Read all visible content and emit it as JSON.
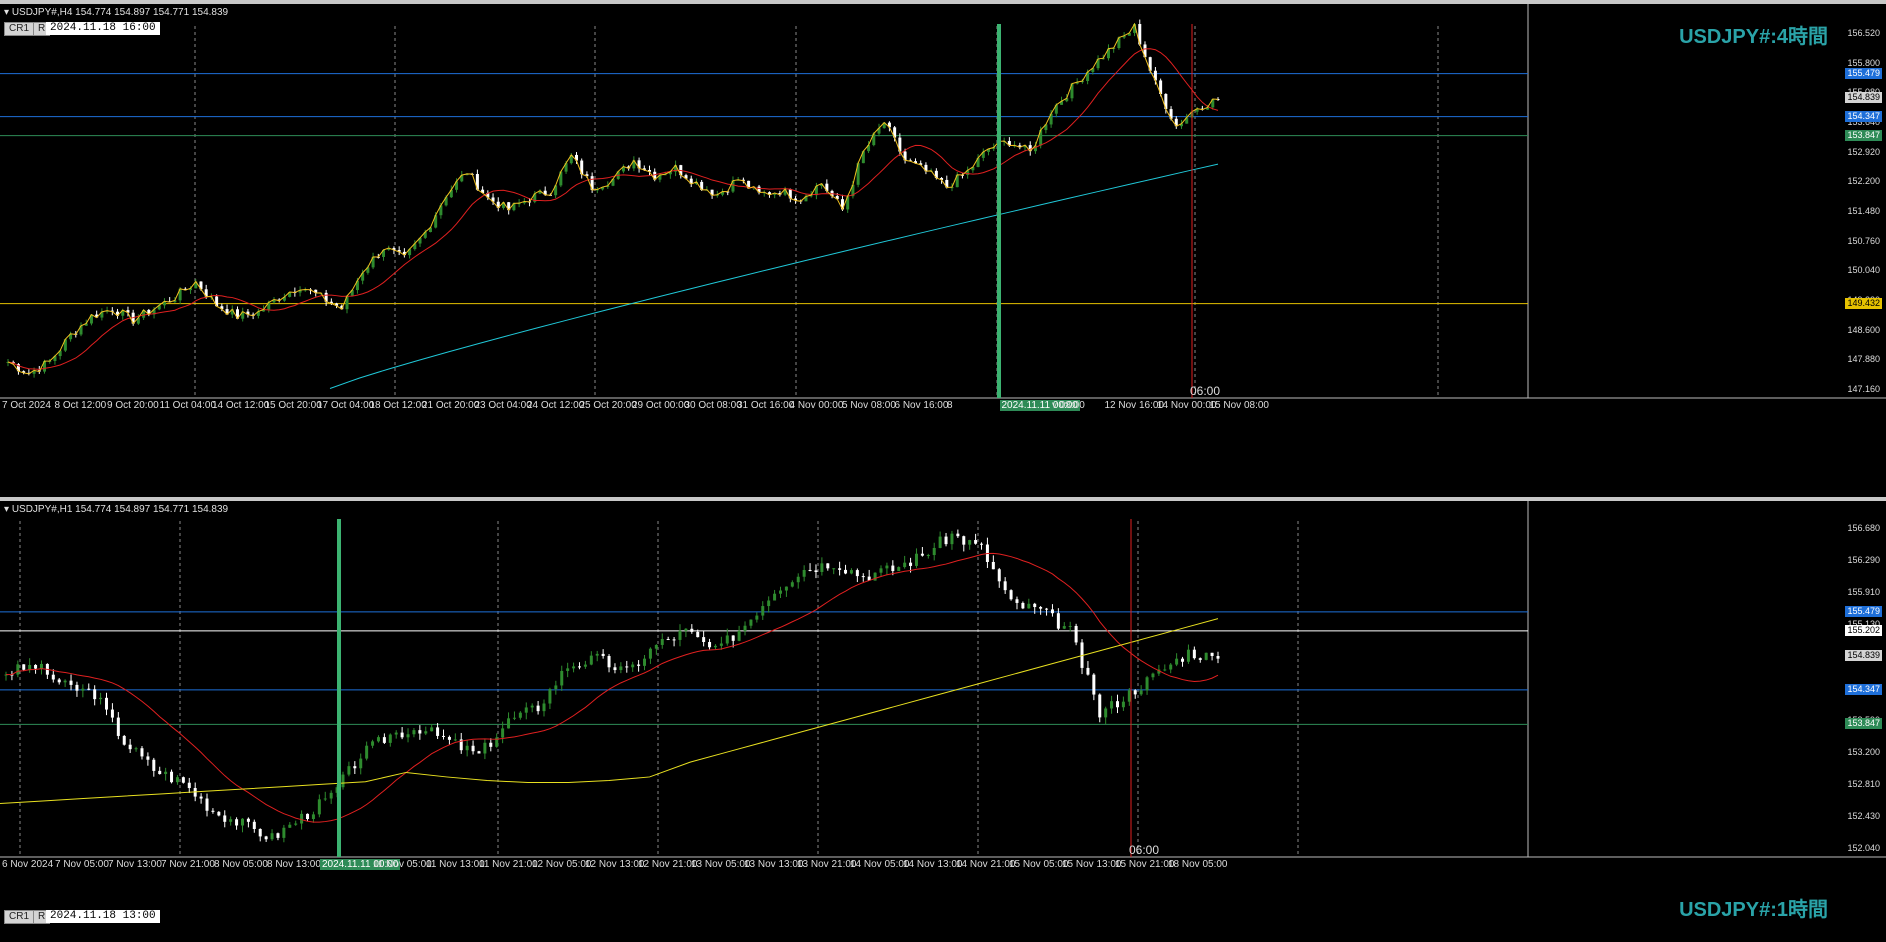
{
  "h4": {
    "header": "USDJPY#,H4  154.774 154.897 154.771 154.839",
    "btn_cr1": "CR1",
    "btn_r": "R",
    "date_box": "2024.11.18 16:00",
    "title": "USDJPY#:4時間",
    "time_marker": "06:00",
    "price_ticks": [
      "156.520",
      "155.800",
      "155.080",
      "153.640",
      "152.920",
      "152.200",
      "151.480",
      "150.760",
      "150.040",
      "149.320",
      "148.600",
      "147.880",
      "147.160"
    ],
    "price_tags": [
      {
        "label": "155.479",
        "color": "#1e6fd9",
        "text_color": "#ffffff"
      },
      {
        "label": "154.839",
        "color": "#d4d4d4",
        "text_color": "#000000"
      },
      {
        "label": "154.347",
        "color": "#1e6fd9",
        "text_color": "#ffffff"
      },
      {
        "label": "153.847",
        "color": "#2e8b57",
        "text_color": "#ffffff"
      },
      {
        "label": "149.432",
        "color": "#e6c200",
        "text_color": "#000000"
      }
    ],
    "time_ticks": [
      "7 Oct 2024",
      "8 Oct 12:00",
      "9 Oct 20:00",
      "11 Oct 04:00",
      "14 Oct 12:00",
      "15 Oct 20:00",
      "17 Oct 04:00",
      "18 Oct 12:00",
      "21 Oct 20:00",
      "23 Oct 04:00",
      "24 Oct 12:00",
      "25 Oct 20:00",
      "29 Oct 00:00",
      "30 Oct 08:00",
      "31 Oct 16:00",
      "4 Nov 00:00",
      "5 Nov 08:00",
      "6 Nov 16:00",
      "8",
      "2024.11.11 00:00",
      "v 08:00",
      "12 Nov 16:00",
      "14 Nov 00:00",
      "15 Nov 08:00"
    ]
  },
  "h1": {
    "header": "USDJPY#,H1  154.774 154.897 154.771 154.839",
    "btn_cr1": "CR1",
    "btn_r": "R",
    "date_box": "2024.11.18 13:00",
    "title": "USDJPY#:1時間",
    "time_marker": "06:00",
    "price_ticks": [
      "156.680",
      "156.290",
      "155.910",
      "155.130",
      "154.750",
      "153.970",
      "153.590",
      "153.200",
      "152.810",
      "152.430",
      "152.040"
    ],
    "price_tags": [
      {
        "label": "155.479",
        "color": "#1e6fd9",
        "text_color": "#ffffff"
      },
      {
        "label": "155.202",
        "color": "#ffffff",
        "text_color": "#000000"
      },
      {
        "label": "154.839",
        "color": "#d4d4d4",
        "text_color": "#000000"
      },
      {
        "label": "154.347",
        "color": "#1e6fd9",
        "text_color": "#ffffff"
      },
      {
        "label": "153.847",
        "color": "#2e8b57",
        "text_color": "#ffffff"
      }
    ],
    "time_ticks": [
      "6 Nov 2024",
      "7 Nov 05:00",
      "7 Nov 13:00",
      "7 Nov 21:00",
      "8 Nov 05:00",
      "8 Nov 13:00",
      "2024.11.11 00:00",
      "11 Nov 05:00",
      "11 Nov 13:00",
      "11 Nov 21:00",
      "12 Nov 05:00",
      "12 Nov 13:00",
      "12 Nov 21:00",
      "13 Nov 05:00",
      "13 Nov 13:00",
      "13 Nov 21:00",
      "14 Nov 05:00",
      "14 Nov 13:00",
      "14 Nov 21:00",
      "15 Nov 05:00",
      "15 Nov 13:00",
      "15 Nov 21:00",
      "18 Nov 05:00"
    ]
  },
  "colors": {
    "bull": "#2e8b2e",
    "bear": "#ffffff",
    "ma_fast": "#e02020",
    "ma_slow_h4": "#20c8d8",
    "ma_slow_h1": "#e8e020",
    "zigzag": "#f0c020",
    "hline_blue": "#1e6fd9",
    "hline_green": "#2e8b57",
    "hline_yellow": "#e6c200",
    "vline_green": "#3cb371",
    "vline_red": "#e02020"
  }
}
